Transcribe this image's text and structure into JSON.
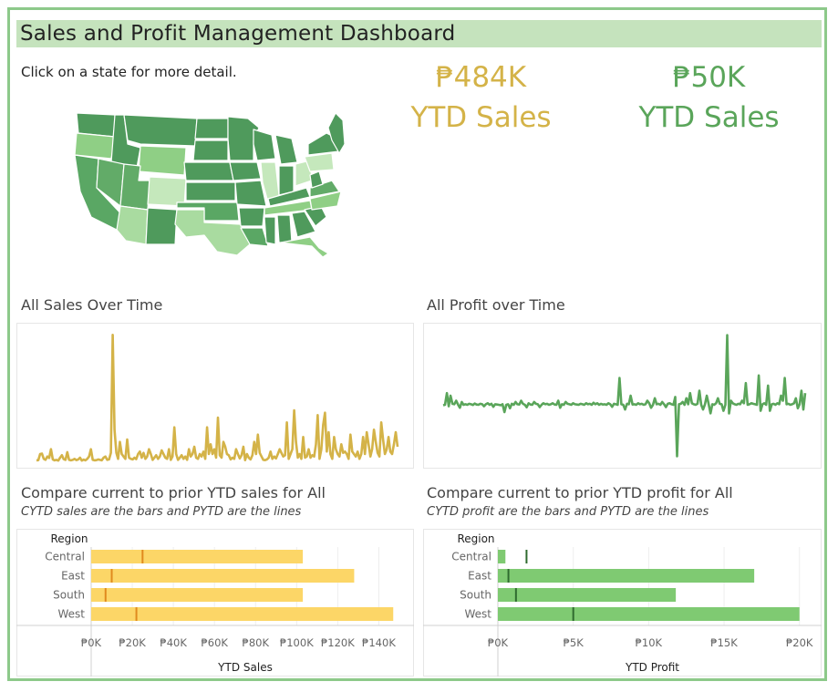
{
  "header": {
    "title": "Sales and Profit Management Dashboard"
  },
  "map": {
    "hint": "Click on a state for more detail."
  },
  "kpis": {
    "sales": {
      "value": "₱484K",
      "label": "YTD Sales",
      "color": "#d4b348"
    },
    "profit": {
      "value": "₱50K",
      "label": "YTD Sales",
      "color": "#5aa55a"
    }
  },
  "colors": {
    "sales": "#d4b348",
    "profit": "#5aa55a",
    "sales_bar": "#fcd667",
    "sales_tick": "#e08a1e",
    "profit_bar": "#7fca72",
    "profit_tick": "#2f6b2f",
    "frame": "#8dc98a",
    "title_bg": "#c5e3bd"
  },
  "sections": {
    "sales_time": "All Sales Over Time",
    "profit_time": "All Profit over Time",
    "sales_compare": "Compare current to prior YTD sales for All",
    "sales_compare_sub": "CYTD sales are the bars and PYTD are the lines",
    "profit_compare": "Compare current to prior YTD profit for All",
    "profit_compare_sub": "CYTD profit are the bars and PYTD are the lines"
  },
  "chart_data": [
    {
      "type": "line",
      "title": "All Sales Over Time",
      "values": [
        40,
        50,
        300,
        320,
        100,
        60,
        200,
        140,
        500,
        80,
        40,
        60,
        30,
        150,
        250,
        90,
        60,
        380,
        60,
        40,
        60,
        100,
        50,
        80,
        150,
        30,
        70,
        40,
        100,
        200,
        500,
        60,
        40,
        50,
        80,
        60,
        40,
        150,
        200,
        60,
        80,
        350,
        5200,
        1300,
        350,
        100,
        800,
        300,
        200,
        100,
        900,
        150,
        100,
        80,
        150,
        90,
        300,
        400,
        150,
        350,
        100,
        200,
        500,
        300,
        60,
        150,
        250,
        100,
        200,
        450,
        300,
        150,
        100,
        500,
        60,
        200,
        1400,
        300,
        60,
        150,
        250,
        100,
        200,
        60,
        500,
        200,
        300,
        600,
        150,
        100,
        300,
        200,
        400,
        100,
        1400,
        300,
        700,
        300,
        500,
        150,
        1800,
        250,
        150,
        800,
        600,
        300,
        250,
        80,
        150,
        100,
        500,
        300,
        120,
        250,
        600,
        50,
        300,
        150,
        80,
        250,
        800,
        300,
        1100,
        350,
        200,
        60,
        50,
        80,
        150,
        400,
        100,
        200,
        120,
        300,
        500,
        350,
        200,
        250,
        1600,
        100,
        300,
        500,
        2100,
        800,
        150,
        300,
        100,
        1000,
        150,
        200,
        500,
        150,
        250,
        200,
        700,
        1900,
        100,
        500,
        1500,
        2000,
        400,
        1200,
        300,
        100,
        1000,
        500,
        300,
        200,
        700,
        350,
        400,
        300,
        100,
        1100,
        400,
        300,
        200,
        400,
        100,
        300,
        1000,
        300,
        1200,
        700,
        200,
        500,
        1300,
        800,
        350,
        200,
        1600,
        900,
        300,
        500,
        1000,
        400,
        300,
        700,
        1200,
        600
      ],
      "ylim": [
        0,
        5400
      ]
    },
    {
      "type": "line",
      "title": "All Profit over Time",
      "values": [
        20,
        40,
        500,
        -20,
        400,
        80,
        60,
        200,
        50,
        -80,
        150,
        40,
        60,
        40,
        80,
        60,
        30,
        90,
        50,
        40,
        80,
        60,
        -20,
        60,
        100,
        40,
        80,
        -40,
        60,
        50,
        40,
        20,
        60,
        -250,
        40,
        60,
        -100,
        80,
        40,
        150,
        60,
        50,
        200,
        80,
        40,
        -60,
        100,
        50,
        40,
        150,
        80,
        60,
        -50,
        40,
        100,
        60,
        80,
        40,
        60,
        100,
        50,
        40,
        200,
        -80,
        60,
        40,
        150,
        80,
        60,
        40,
        100,
        60,
        50,
        40,
        80,
        60,
        40,
        100,
        60,
        80,
        40,
        120,
        60,
        100,
        40,
        80,
        50,
        60,
        40,
        100,
        60,
        -40,
        80,
        60,
        40,
        1100,
        60,
        40,
        -150,
        80,
        60,
        400,
        50,
        60,
        40,
        100,
        60,
        80,
        40,
        60,
        200,
        100,
        -80,
        40,
        300,
        60,
        80,
        40,
        150,
        60,
        -50,
        80,
        100,
        60,
        40,
        350,
        -2000,
        60,
        80,
        150,
        40,
        300,
        60,
        500,
        100,
        60,
        40,
        80,
        600,
        40,
        -150,
        60,
        400,
        80,
        -300,
        60,
        40,
        100,
        300,
        80,
        60,
        -200,
        40,
        2800,
        -300,
        200,
        100,
        60,
        40,
        80,
        60,
        200,
        100,
        900,
        40,
        60,
        100,
        80,
        60,
        40,
        1200,
        -200,
        60,
        100,
        40,
        800,
        -200,
        60,
        80,
        40,
        100,
        60,
        400,
        200,
        1100,
        60,
        80,
        40,
        60,
        100,
        300,
        -100,
        60,
        600,
        -150,
        500
      ],
      "ylim": [
        -2200,
        3000
      ]
    },
    {
      "type": "bar",
      "title": "Compare current to prior YTD sales for All",
      "subtitle": "CYTD sales are the bars and PYTD are the lines",
      "categories": [
        "Central",
        "East",
        "South",
        "West"
      ],
      "series": [
        {
          "name": "CYTD",
          "values": [
            103000,
            128000,
            103000,
            147000
          ]
        },
        {
          "name": "PYTD",
          "values": [
            25000,
            10000,
            7000,
            22000
          ]
        }
      ],
      "category_label": "Region",
      "xlabel": "YTD Sales",
      "xlim": [
        0,
        150000
      ],
      "tick_labels": [
        "₱0K",
        "₱20K",
        "₱40K",
        "₱60K",
        "₱80K",
        "₱100K",
        "₱120K",
        "₱140K"
      ],
      "ticks": [
        0,
        20000,
        40000,
        60000,
        80000,
        100000,
        120000,
        140000
      ]
    },
    {
      "type": "bar",
      "title": "Compare current to prior YTD profit for All",
      "subtitle": "CYTD profit are the bars and PYTD are the lines",
      "categories": [
        "Central",
        "East",
        "South",
        "West"
      ],
      "series": [
        {
          "name": "CYTD",
          "values": [
            500,
            17000,
            11800,
            20000
          ]
        },
        {
          "name": "PYTD",
          "values": [
            1900,
            700,
            1200,
            5000
          ]
        }
      ],
      "category_label": "Region",
      "xlabel": "YTD Profit",
      "xlim": [
        0,
        20500
      ],
      "tick_labels": [
        "₱0K",
        "₱5K",
        "₱10K",
        "₱15K",
        "₱20K"
      ],
      "ticks": [
        0,
        5000,
        10000,
        15000,
        20000
      ]
    }
  ]
}
